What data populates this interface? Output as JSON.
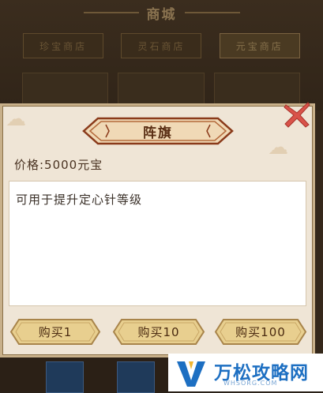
{
  "background": {
    "title": "商城",
    "tabs": [
      "珍宝商店",
      "灵石商店",
      "元宝商店"
    ],
    "active_tab_index": 2
  },
  "dialog": {
    "title": "阵旗",
    "price": "价格:5000元宝",
    "description": "可用于提升定心针等级",
    "buttons": {
      "buy_1": "购买1",
      "buy_10": "购买10",
      "buy_100": "购买100"
    },
    "close_icon": "close-x-icon"
  },
  "watermark": {
    "name": "万松攻略网",
    "domain": "WHSORG.COM"
  },
  "colors": {
    "dialog_bg": "#efe5d6",
    "banner": "#8a3a1a",
    "button_gold": "#e8cf8f",
    "close_red": "#d9534a"
  }
}
